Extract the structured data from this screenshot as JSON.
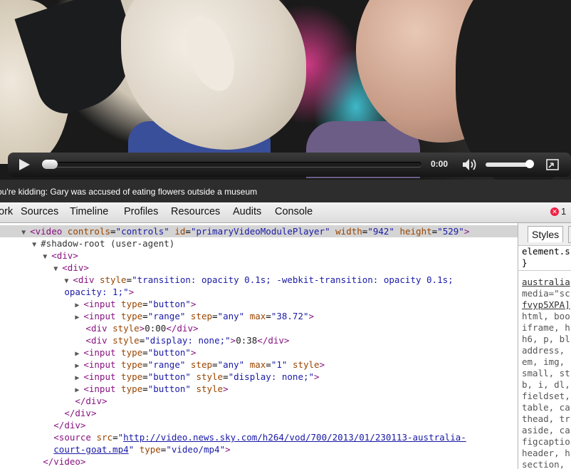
{
  "video": {
    "time_display": "0:00",
    "progress": 0.0,
    "volume": 0.9
  },
  "caption": "ou're kidding: Gary was accused of eating flowers outside a museum",
  "devtools": {
    "tabs": [
      "ork",
      "Sources",
      "Timeline",
      "Profiles",
      "Resources",
      "Audits",
      "Console"
    ],
    "error_count": "1",
    "error_icon": "error-circle-icon"
  },
  "elements": {
    "video_tag": {
      "open": "<video",
      "attrs": [
        {
          "name": "controls",
          "value": "\"controls\""
        },
        {
          "name": "id",
          "value": "\"primaryVideoModulePlayer\""
        },
        {
          "name": "width",
          "value": "\"942\""
        },
        {
          "name": "height",
          "value": "\"529\""
        }
      ],
      "close": ">"
    },
    "shadow_root": "#shadow-root (user-agent)",
    "div1": "<div>",
    "div2": "<div>",
    "div3_open": "<div",
    "div3_style_name": "style",
    "div3_style_value": "\"transition: opacity 0.1s; -webkit-transition: opacity 0.1s;",
    "div3_style_cont": "opacity: 1;\"",
    "div3_close": ">",
    "input1": {
      "type_attr": "type",
      "type_val": "\"button\""
    },
    "input2": {
      "type_val": "\"range\"",
      "step_val": "\"any\"",
      "max_val": "\"38.72\""
    },
    "div_time": {
      "style_attr": "style",
      "text": "0:00"
    },
    "div_dur": {
      "style_val": "\"display: none;\"",
      "text": "0:38"
    },
    "input3": {
      "type_val": "\"button\""
    },
    "input4": {
      "type_val": "\"range\"",
      "step_val": "\"any\"",
      "max_val": "\"1\"",
      "extra": "style"
    },
    "input5": {
      "type_val": "\"button\"",
      "style_val": "\"display: none;\""
    },
    "input6": {
      "type_val": "\"button\"",
      "extra": "style"
    },
    "close_div": "</div>",
    "source": {
      "src_url": "http://video.news.sky.com/h264/vod/700/2013/01/230113-australia-",
      "src_url2": "court-goat.mp4",
      "type_val": "\"video/mp4\""
    },
    "close_video": "</video>"
  },
  "styles_pane": {
    "tabs": [
      "Styles",
      "C"
    ],
    "lines": [
      "element.s",
      "}",
      "australia",
      "media=\"sc",
      "fvyp5XPA]",
      "html, boo",
      "iframe, h",
      "h6, p, bl",
      "address, ",
      "em, img, ",
      "small, st",
      "b, i, dl,",
      "fieldset,",
      "table, ca",
      "thead, tr",
      "aside, ca",
      "figcaptio",
      "header, h",
      "section, "
    ]
  }
}
